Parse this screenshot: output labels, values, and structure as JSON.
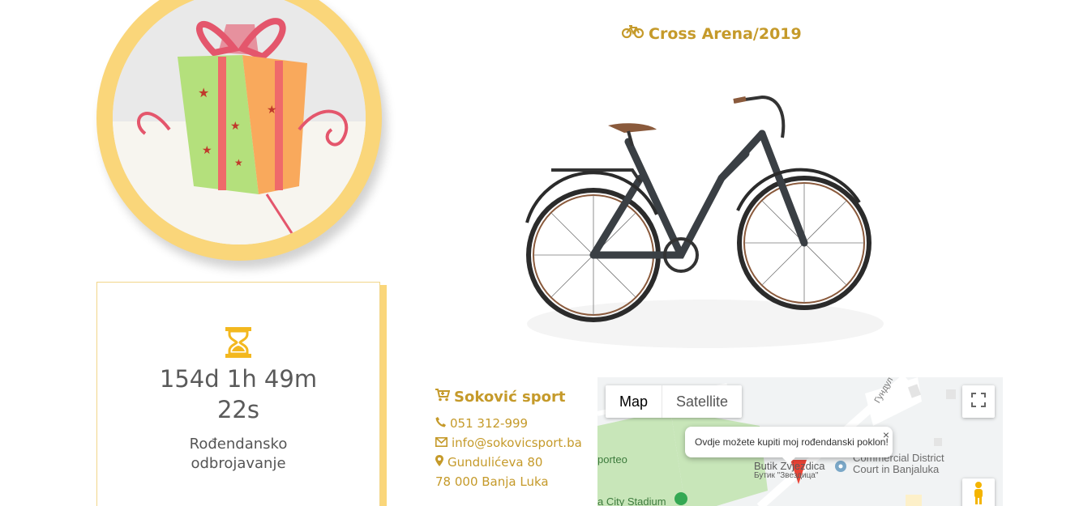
{
  "bike": {
    "title": "Cross Arena/2019",
    "icon": "bicycle-icon"
  },
  "countdown": {
    "icon": "hourglass-icon",
    "time_line1": "154d 1h 49m",
    "time_line2": "22s",
    "label_line1": "Rođendansko",
    "label_line2": "odbrojavanje"
  },
  "shop": {
    "name": "Soković sport",
    "phone": "051 312-999",
    "email": "info@sokovicsport.ba",
    "street": "Gundulićeva 80",
    "city": "78 000 Banja Luka"
  },
  "map": {
    "tab_map": "Map",
    "tab_satellite": "Satellite",
    "info_text": "Ovdje možete kupiti moj rođendanski poklon!",
    "info_close": "×",
    "label_shop_latin": "Butik Zvjezdica",
    "label_shop_cyr": "Бутик \"Звездица\"",
    "label_court_1": "Commercial District",
    "label_court_2": "Court in Banjaluka",
    "label_stadium": "a City Stadium",
    "label_sporteo": "porteo",
    "label_street": "Гундул"
  },
  "colors": {
    "accent": "#c59a2a",
    "circle": "#fad67a",
    "map_park": "#c8e6b9"
  }
}
